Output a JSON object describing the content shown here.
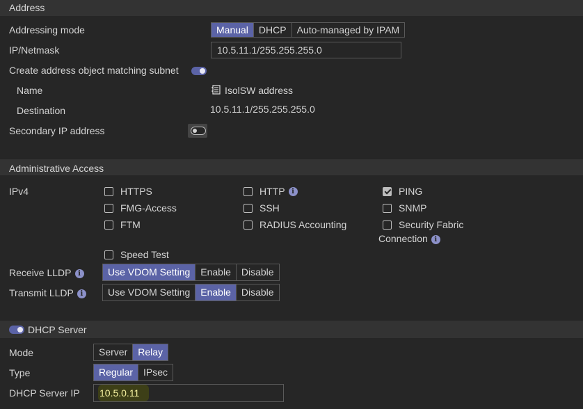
{
  "address": {
    "section_title": "Address",
    "addressing_mode_label": "Addressing mode",
    "addressing_mode_options": [
      "Manual",
      "DHCP",
      "Auto-managed by IPAM"
    ],
    "ip_netmask_label": "IP/Netmask",
    "ip_netmask_value": "10.5.11.1/255.255.255.0",
    "create_object_label": "Create address object matching subnet",
    "create_object_enabled": true,
    "name_label": "Name",
    "name_value": "IsolSW address",
    "destination_label": "Destination",
    "destination_value": "10.5.11.1/255.255.255.0",
    "secondary_ip_label": "Secondary IP address",
    "secondary_ip_enabled": false
  },
  "admin_access": {
    "section_title": "Administrative Access",
    "ipv4_label": "IPv4",
    "protocols": {
      "https": {
        "label": "HTTPS",
        "checked": false
      },
      "http": {
        "label": "HTTP",
        "checked": false
      },
      "ping": {
        "label": "PING",
        "checked": true
      },
      "fmg": {
        "label": "FMG-Access",
        "checked": false
      },
      "ssh": {
        "label": "SSH",
        "checked": false
      },
      "snmp": {
        "label": "SNMP",
        "checked": false
      },
      "ftm": {
        "label": "FTM",
        "checked": false
      },
      "radius": {
        "label": "RADIUS Accounting",
        "checked": false
      },
      "security_fabric_line1": "Security Fabric",
      "security_fabric_line2": "Connection",
      "security_fabric_checked": false,
      "speed_test": {
        "label": "Speed Test",
        "checked": false
      }
    },
    "receive_lldp_label": "Receive LLDP",
    "receive_lldp_options": [
      "Use VDOM Setting",
      "Enable",
      "Disable"
    ],
    "receive_lldp_selected": "Use VDOM Setting",
    "transmit_lldp_label": "Transmit LLDP",
    "transmit_lldp_options": [
      "Use VDOM Setting",
      "Enable",
      "Disable"
    ],
    "transmit_lldp_selected": "Enable"
  },
  "dhcp": {
    "section_title": "DHCP Server",
    "enabled": true,
    "mode_label": "Mode",
    "mode_options": [
      "Server",
      "Relay"
    ],
    "mode_selected": "Relay",
    "type_label": "Type",
    "type_options": [
      "Regular",
      "IPsec"
    ],
    "type_selected": "Regular",
    "server_ip_label": "DHCP Server IP",
    "server_ip_value": "10.5.0.11"
  },
  "colors": {
    "background": "#262626",
    "section_header": "#333333",
    "accent": "#5b63a6",
    "info_icon": "#8c91c9",
    "highlight": "#3d3f17"
  },
  "icons": {
    "info": "info-circle-icon",
    "address_object": "address-book-icon"
  }
}
